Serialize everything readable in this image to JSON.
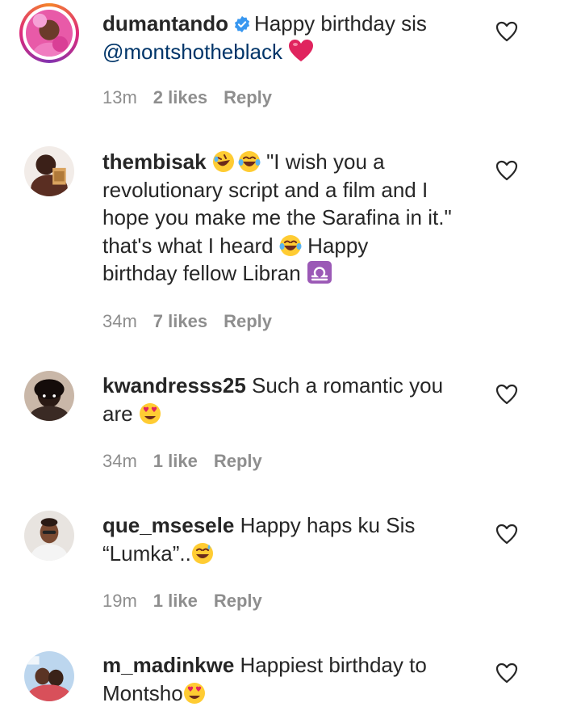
{
  "comments": [
    {
      "username": "dumantando",
      "verified": true,
      "text_1": "Happy birthday sis",
      "text_2": "@montshotheblack",
      "time": "13m",
      "likes": "2 likes",
      "reply": "Reply"
    },
    {
      "username": "thembisak",
      "text_1": "\"I wish you a",
      "text_2": "revolutionary script and a film and I",
      "text_3": "hope you make me the Sarafina in it.\"",
      "text_4": "that's what I heard",
      "text_5": "Happy",
      "text_6": "birthday fellow Libran",
      "time": "34m",
      "likes": "7 likes",
      "reply": "Reply"
    },
    {
      "username": "kwandresss25",
      "text_1": "Such a romantic you",
      "text_2": "are",
      "time": "34m",
      "likes": "1 like",
      "reply": "Reply"
    },
    {
      "username": "que_msesele",
      "text_1": "Happy haps ku Sis",
      "text_2": "“Lumka”..",
      "time": "19m",
      "likes": "1 like",
      "reply": "Reply"
    },
    {
      "username": "m_madinkwe",
      "text_1": "Happiest birthday to",
      "text_2": "Montsho",
      "time": "",
      "likes": "",
      "reply": ""
    }
  ],
  "icons": {
    "like": "heart-outline-icon",
    "verified": "verified-badge-icon"
  },
  "colors": {
    "text": "#262626",
    "meta": "#8e8e8e",
    "verified": "#3897f0",
    "heart_emoji": "#e0245e"
  }
}
